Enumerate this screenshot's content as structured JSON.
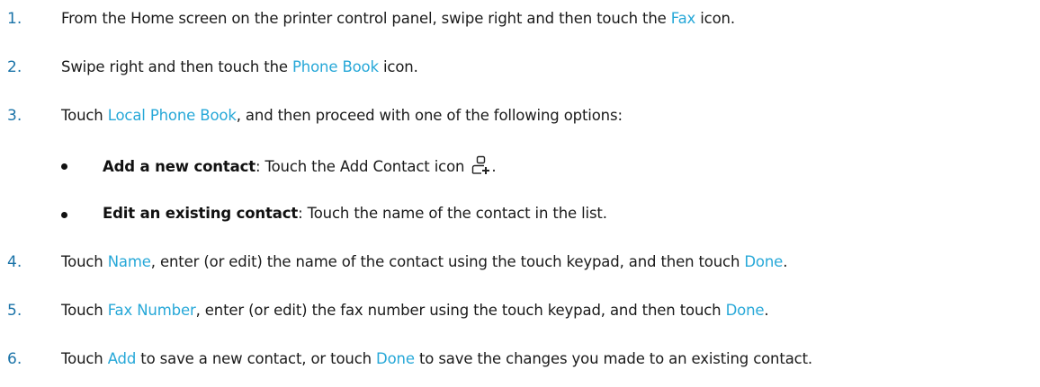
{
  "steps": [
    {
      "number": "1.",
      "pre": "From the Home screen on the printer control panel, swipe right and then touch the ",
      "link": "Fax",
      "post": " icon."
    },
    {
      "number": "2.",
      "pre": "Swipe right and then touch the ",
      "link": "Phone Book",
      "post": " icon."
    },
    {
      "number": "3.",
      "pre": "Touch ",
      "link": "Local Phone Book",
      "post": ", and then proceed with one of the following options:"
    },
    {
      "number": "4.",
      "pre": "Touch ",
      "link": "Name",
      "mid": ", enter (or edit) the name of the contact using the touch keypad, and then touch ",
      "link2": "Done",
      "post": "."
    },
    {
      "number": "5.",
      "pre": "Touch ",
      "link": "Fax Number",
      "mid": ", enter (or edit) the fax number using the touch keypad, and then touch ",
      "link2": "Done",
      "post": "."
    },
    {
      "number": "6.",
      "pre": "Touch ",
      "link": "Add",
      "mid": " to save a new contact, or touch ",
      "link2": "Done",
      "post": " to save the changes you made to an existing contact."
    }
  ],
  "options": [
    {
      "bold": "Add a new contact",
      "text": ": Touch the Add Contact icon ",
      "icon": "add-contact-icon",
      "post": "."
    },
    {
      "bold": "Edit an existing contact",
      "text": ": Touch the name of the contact in the list."
    }
  ],
  "colors": {
    "number": "#1a73a8",
    "link": "#27a8d8",
    "text": "#1a1a1a"
  }
}
